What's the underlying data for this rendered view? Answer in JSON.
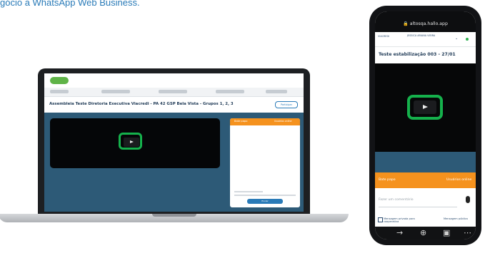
{
  "caption": "gócio a WhatsApp Web Business.",
  "laptop": {
    "meeting_title": "Assembleia Teste Diretoria Executiva Viacredi - PA 42 GSP Bela Vista - Grupos 1, 2, 3",
    "header_btn": "Participar",
    "chat_title": "Bate papo",
    "chat_sub": "Usuários online",
    "send_label": "Enviar"
  },
  "phone": {
    "url": "altosqa.hallo.app",
    "status_left": "VIACREDI",
    "status_right": "JESSICA ARIANA VIEIRA",
    "event_title": "Teste estabilização 003 - 27/01",
    "chat_title": "Bate papo",
    "chat_sub": "Usuários online",
    "input_placeholder": "Fazer um comentário",
    "option1": "Mensagem privada para cooperativa",
    "option2": "Mensagem pública"
  },
  "icons": [
    "play-icon",
    "lock-icon",
    "mic-icon",
    "back-icon",
    "plus-icon",
    "tabs-icon",
    "menu-icon"
  ],
  "colors": {
    "highlight": "#15b14c",
    "chat_header": "#f5921e",
    "content_bg": "#2d5a77"
  }
}
